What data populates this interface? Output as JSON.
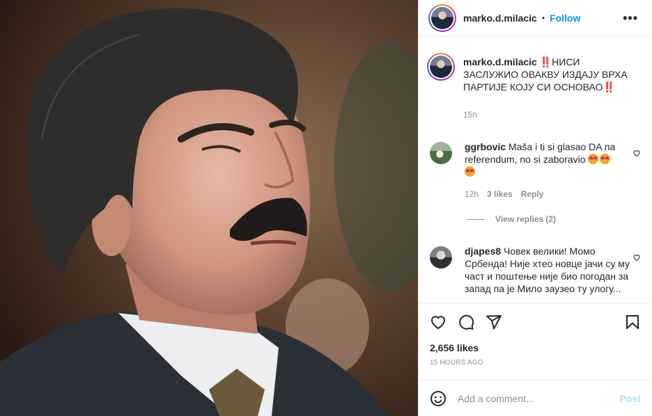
{
  "header": {
    "username": "marko.d.milacic",
    "separator": "•",
    "follow_label": "Follow",
    "more_label": "•••"
  },
  "caption": {
    "username": "marko.d.milacic",
    "text": "‼️НИСИ ЗАСЛУЖИО ОВАКВУ ИЗДАЈУ ВРХА ПАРТИЈЕ КОЈУ СИ ОСНОВАО‼️",
    "time": "15h"
  },
  "comments": [
    {
      "username": "ggrbovic",
      "text": "Maša i ti si glasao DA na referendum, no si zaboravio",
      "time": "12h",
      "likes": "3 likes",
      "reply_label": "Reply",
      "view_replies": "View replies (2)"
    },
    {
      "username": "djapes8",
      "text": "Човек велики! Момо Србенда! Није хтео новце јачи су му част и поштење није био погодан за запад па је Мило заузео ту улогу..."
    }
  ],
  "actions": {
    "likes": "2,656 likes",
    "time_ago": "15 HOURS AGO"
  },
  "add_comment": {
    "placeholder": "Add a comment...",
    "post_label": "Post"
  },
  "icons": [
    "like-icon",
    "comment-icon",
    "share-icon",
    "bookmark-icon",
    "emoji-icon",
    "more-icon"
  ],
  "colors": {
    "accent": "#0095f6",
    "post_disabled": "#b2dffc",
    "muted": "#8e8e8e"
  }
}
